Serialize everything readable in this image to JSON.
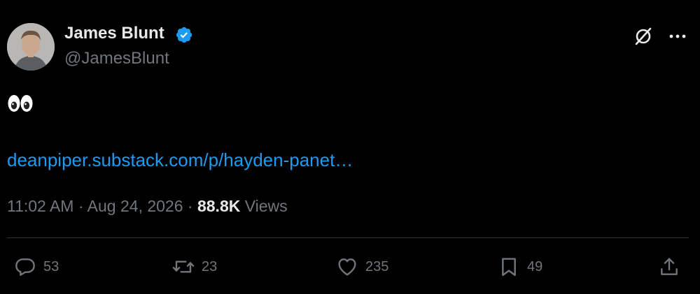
{
  "author": {
    "name": "James Blunt",
    "handle": "@JamesBlunt",
    "verified": true,
    "verified_color": "#1d9bf0"
  },
  "tweet": {
    "emoji": "👀",
    "link_text": "deanpiper.substack.com/p/hayden-panet…",
    "link_color": "#1d9bf0"
  },
  "meta": {
    "time": "11:02 AM",
    "separator": "·",
    "date": "Aug 24, 2026",
    "views_count": "88.8K",
    "views_label": "Views"
  },
  "actions": {
    "replies": "53",
    "reposts": "23",
    "likes": "235",
    "bookmarks": "49"
  },
  "icons": {
    "header": [
      "grok-icon",
      "more-icon"
    ],
    "actions": [
      "reply-icon",
      "repost-icon",
      "like-icon",
      "bookmark-icon",
      "share-icon"
    ]
  },
  "colors": {
    "background": "#000000",
    "text": "#e7e9ea",
    "muted": "#71767b",
    "divider": "#2f3336"
  }
}
